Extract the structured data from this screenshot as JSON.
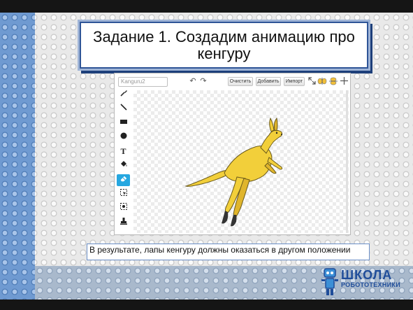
{
  "slide": {
    "title": "Задание 1. Создадим анимацию про кенгуру",
    "caption": "В результате, лапы кенгуру должны оказаться в другом положении"
  },
  "editor": {
    "costume_name": "Kanguru2",
    "toolbar": {
      "undo_icon": "undo-icon",
      "redo_icon": "redo-icon",
      "clear_label": "Очистить",
      "add_label": "Добавить",
      "import_label": "Импорт"
    },
    "tools": [
      "brush-icon",
      "line-icon",
      "rectangle-icon",
      "ellipse-icon",
      "text-icon",
      "fill-icon",
      "eraser-icon",
      "select-icon",
      "stamp-select-icon",
      "stamp-icon"
    ],
    "active_tool": "eraser-icon",
    "tool_glyphs": {
      "text": "T"
    }
  },
  "logo": {
    "line1": "ШКОЛА",
    "line2": "РОБОТОТЕХНИКИ"
  },
  "colors": {
    "title_border": "#2f5597",
    "kangaroo": "#f2cf3a",
    "active_tool": "#26a7e0"
  }
}
